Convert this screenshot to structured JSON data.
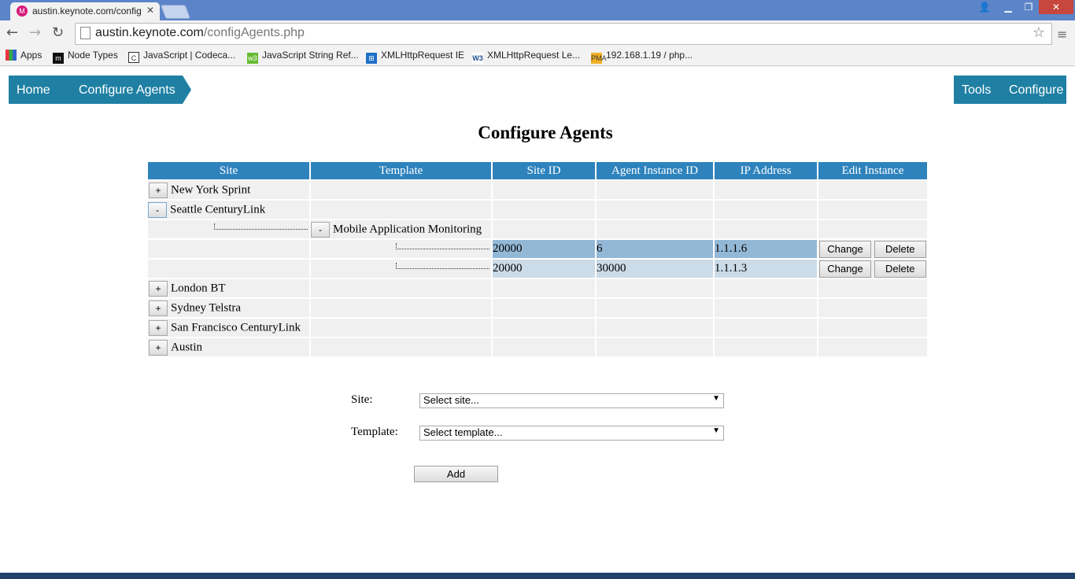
{
  "browser": {
    "tab_title": "austin.keynote.com/config",
    "url_host": "austin.keynote.com",
    "url_path": "/configAgents.php",
    "bookmarks": [
      {
        "label": "Apps",
        "icon": "apps-grid-icon"
      },
      {
        "label": "Node Types",
        "icon": "m-logo-icon"
      },
      {
        "label": "JavaScript | Codeca...",
        "icon": "codecademy-icon"
      },
      {
        "label": "JavaScript String Ref...",
        "icon": "w3schools-icon"
      },
      {
        "label": "XMLHttpRequest IE",
        "icon": "windows-icon"
      },
      {
        "label": "XMLHttpRequest Le...",
        "icon": "w3c-icon"
      },
      {
        "label": "192.168.1.19 / php...",
        "icon": "phpmyadmin-icon"
      }
    ]
  },
  "nav": {
    "home": "Home",
    "configure_agents": "Configure Agents",
    "tools": "Tools",
    "configure": "Configure"
  },
  "page": {
    "title": "Configure Agents"
  },
  "table": {
    "headers": [
      "Site",
      "Template",
      "Site ID",
      "Agent Instance ID",
      "IP Address",
      "Edit Instance"
    ],
    "sites": [
      {
        "toggle": "+",
        "name": "New York Sprint"
      },
      {
        "toggle": "-",
        "name": "Seattle CenturyLink"
      },
      {
        "toggle": "+",
        "name": "London BT"
      },
      {
        "toggle": "+",
        "name": "Sydney Telstra"
      },
      {
        "toggle": "+",
        "name": "San Francisco CenturyLink"
      },
      {
        "toggle": "+",
        "name": "Austin"
      }
    ],
    "template_row": {
      "toggle": "-",
      "name": "Mobile Application Monitoring"
    },
    "instances": [
      {
        "site_id": "20000",
        "agent_instance_id": "6",
        "ip_address": "1.1.1.6"
      },
      {
        "site_id": "20000",
        "agent_instance_id": "30000",
        "ip_address": "1.1.1.3"
      }
    ],
    "change_label": "Change",
    "delete_label": "Delete"
  },
  "form": {
    "site_label": "Site:",
    "site_value": "Select site...",
    "template_label": "Template:",
    "template_value": "Select template...",
    "add_label": "Add"
  },
  "colors": {
    "nav_bg": "#1f80a3",
    "header_bg": "#2e83bd",
    "selected_row": "#93b8d6",
    "alt_selected_row": "#cbdbe7"
  }
}
